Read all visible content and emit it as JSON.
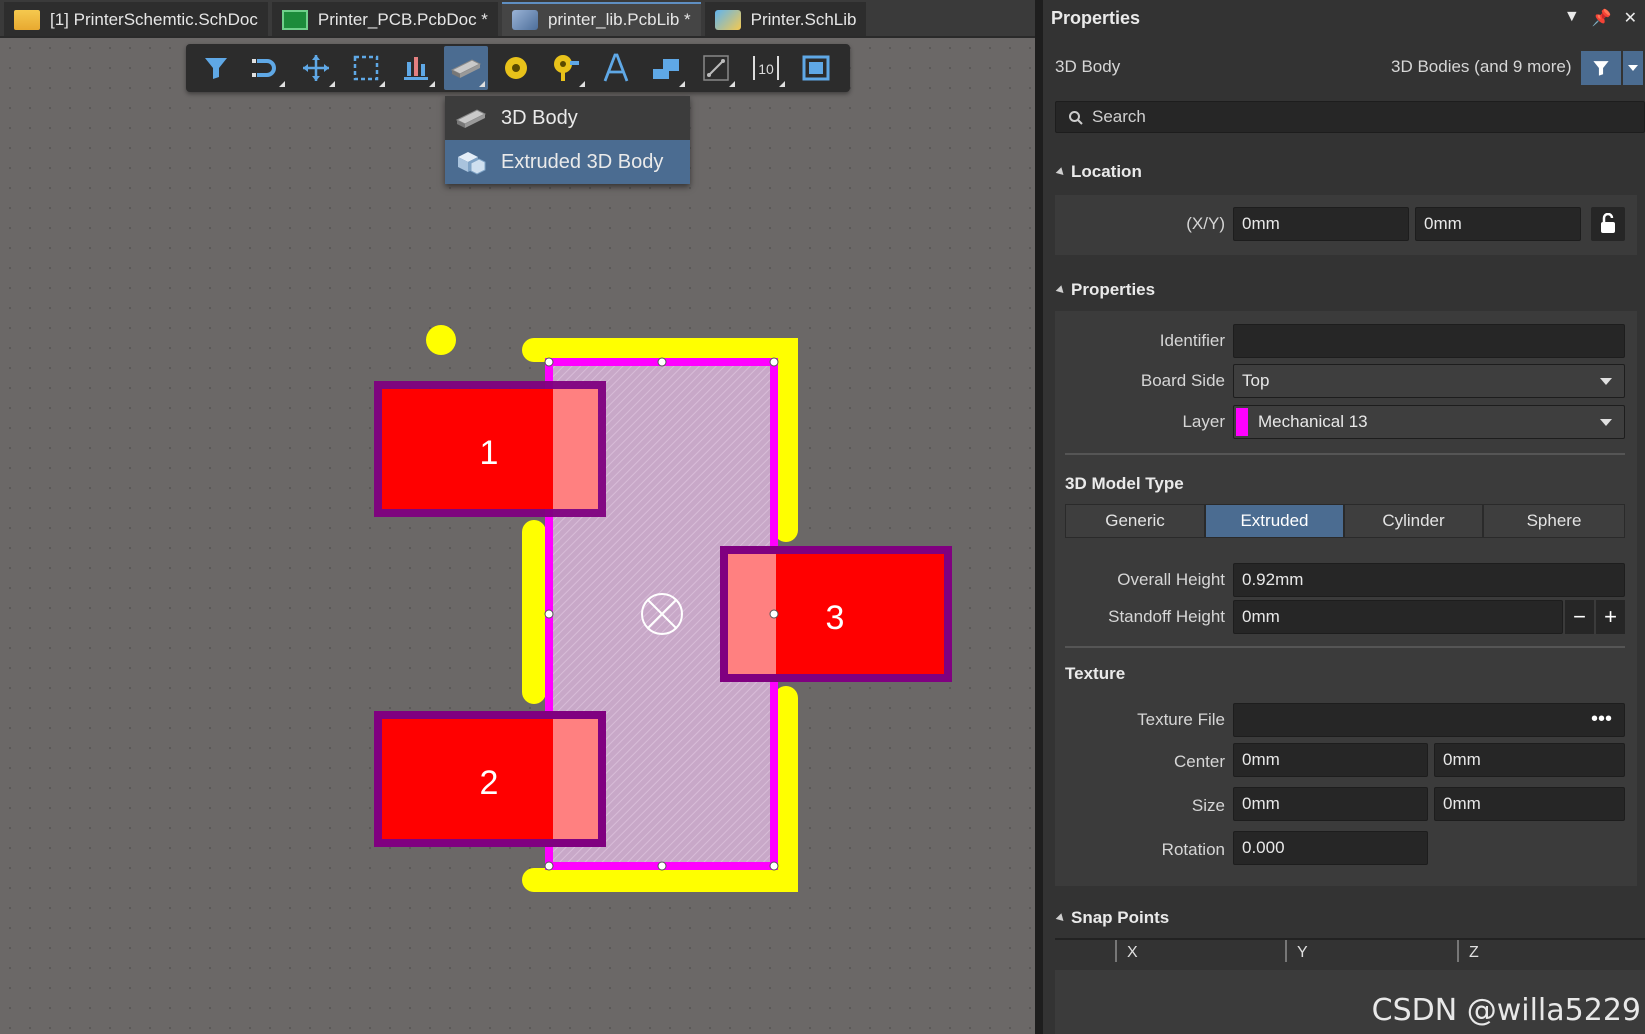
{
  "tabs": [
    {
      "label": "[1] PrinterSchemtic.SchDoc",
      "icon": "schematic-doc-icon"
    },
    {
      "label": "Printer_PCB.PcbDoc *",
      "icon": "pcb-doc-icon"
    },
    {
      "label": "printer_lib.PcbLib *",
      "icon": "pcb-lib-icon"
    },
    {
      "label": "Printer.SchLib",
      "icon": "sch-lib-icon"
    }
  ],
  "toolbar": {
    "items": [
      "filter-icon",
      "interactive-routing-icon",
      "move-icon",
      "select-rect-icon",
      "align-icon",
      "3d-body-icon",
      "pad-icon",
      "via-icon",
      "text-icon",
      "fill-icon",
      "line-icon",
      "dimension-icon",
      "region-icon"
    ],
    "dimension_label": "10"
  },
  "dropdown": {
    "items": [
      "3D Body",
      "Extruded 3D Body"
    ]
  },
  "pads": [
    {
      "label": "1"
    },
    {
      "label": "2"
    },
    {
      "label": "3"
    }
  ],
  "panel": {
    "title": "Properties",
    "object_type": "3D Body",
    "selection_summary": "3D Bodies (and 9 more)",
    "search_placeholder": "Search",
    "location": {
      "section": "Location",
      "xy_label": "(X/Y)",
      "x": "0mm",
      "y": "0mm"
    },
    "properties": {
      "section": "Properties",
      "identifier_label": "Identifier",
      "identifier_value": "",
      "board_side_label": "Board Side",
      "board_side_value": "Top",
      "layer_label": "Layer",
      "layer_value": "Mechanical 13",
      "layer_color": "#ff00ff"
    },
    "model_type": {
      "section": "3D Model Type",
      "options": [
        "Generic",
        "Extruded",
        "Cylinder",
        "Sphere"
      ],
      "selected": "Extruded",
      "overall_height_label": "Overall Height",
      "overall_height": "0.92mm",
      "standoff_height_label": "Standoff Height",
      "standoff_height": "0mm"
    },
    "texture": {
      "section": "Texture",
      "file_label": "Texture File",
      "file_value": "",
      "center_label": "Center",
      "center_x": "0mm",
      "center_y": "0mm",
      "size_label": "Size",
      "size_x": "0mm",
      "size_y": "0mm",
      "rotation_label": "Rotation",
      "rotation": "0.000"
    },
    "snap_points": {
      "section": "Snap Points",
      "columns": [
        "X",
        "Y",
        "Z"
      ]
    }
  },
  "watermark": "CSDN @willa5229",
  "colors": {
    "accent": "#4b6c91",
    "pad": "#ff0000",
    "solder_mask": "#800080",
    "silkscreen": "#ffff00",
    "body_outline": "#ff00ff"
  }
}
